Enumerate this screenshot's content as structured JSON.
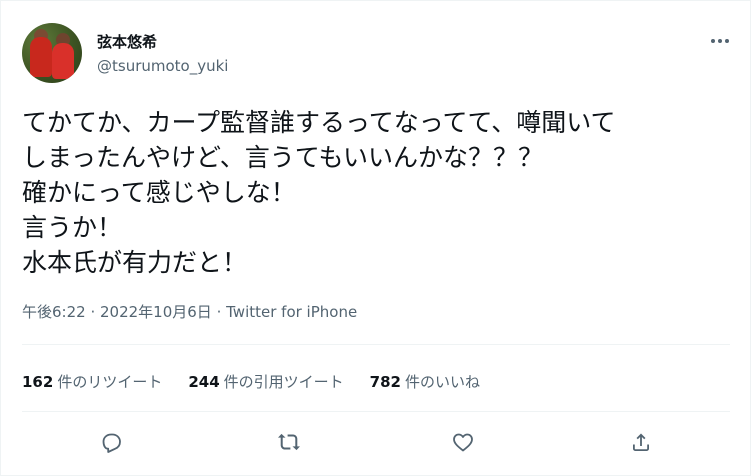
{
  "user": {
    "display_name": "弦本悠希",
    "handle": "@tsurumoto_yuki"
  },
  "tweet": {
    "lines": [
      "てかてか、カープ監督誰するってなってて、噂聞いて",
      "しまったんやけど、言うてもいいんかな？？？",
      "確かにって感じやしな！",
      "言うか！",
      "水本氏が有力だと！"
    ]
  },
  "meta": {
    "time": "午後6:22",
    "separator": " · ",
    "date": "2022年10月6日",
    "source": "Twitter for iPhone"
  },
  "stats": {
    "retweets_count": "162",
    "retweets_label": "件のリツイート",
    "quotes_count": "244",
    "quotes_label": "件の引用ツイート",
    "likes_count": "782",
    "likes_label": "件のいいね"
  },
  "icons": {
    "more": "more-icon",
    "reply": "reply-icon",
    "retweet": "retweet-icon",
    "like": "like-icon",
    "share": "share-icon"
  },
  "colors": {
    "text": "#0f1419",
    "secondary": "#536471",
    "divider": "#eff3f4"
  }
}
